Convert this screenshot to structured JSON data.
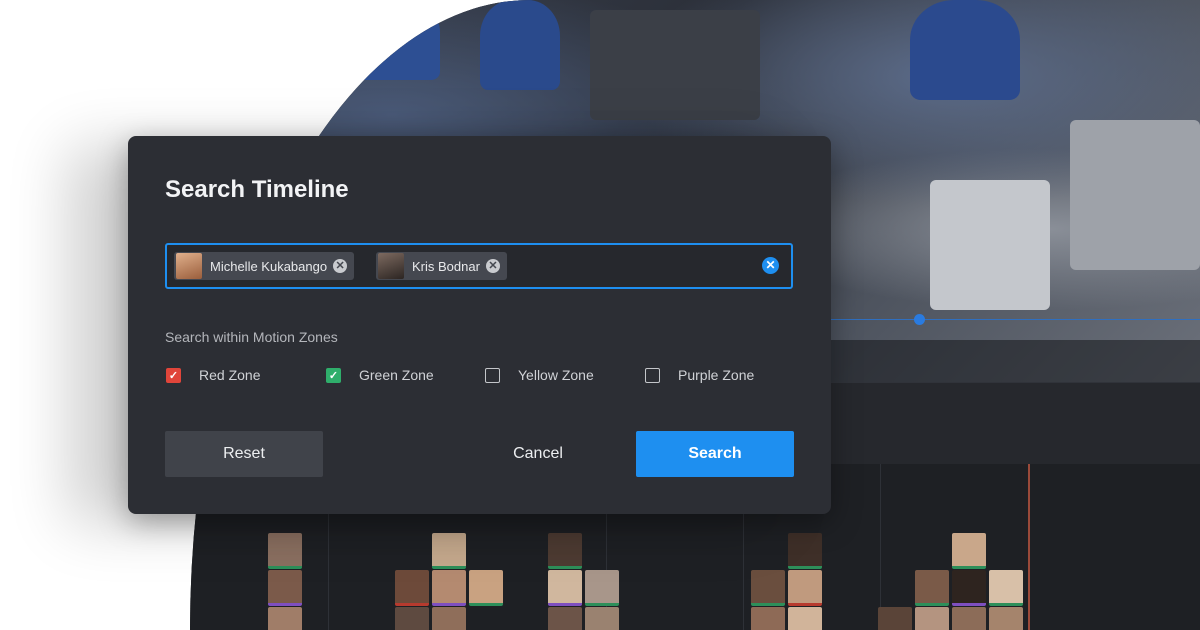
{
  "dialog": {
    "title": "Search Timeline",
    "search": {
      "chips": [
        {
          "label": "Michelle Kukabango",
          "remove_icon": "close-circle-icon"
        },
        {
          "label": "Kris Bodnar",
          "remove_icon": "close-circle-icon"
        }
      ],
      "clear_icon": "close-circle-icon"
    },
    "zones_label": "Search within Motion Zones",
    "zones": [
      {
        "label": "Red Zone",
        "checked": true,
        "color": "#e0453a"
      },
      {
        "label": "Green Zone",
        "checked": true,
        "color": "#2fae6b"
      },
      {
        "label": "Yellow Zone",
        "checked": false
      },
      {
        "label": "Purple Zone",
        "checked": false
      }
    ],
    "buttons": {
      "reset": "Reset",
      "cancel": "Cancel",
      "search": "Search"
    }
  },
  "colors": {
    "accent": "#1e8ff0",
    "dialog_bg": "#2c2e34",
    "app_bg": "#202226"
  }
}
